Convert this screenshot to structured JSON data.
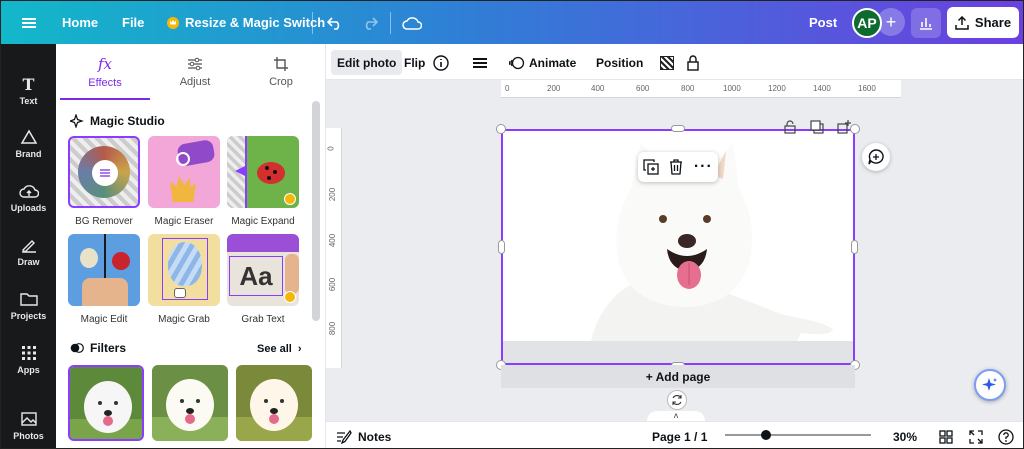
{
  "topbar": {
    "home": "Home",
    "file": "File",
    "resize": "Resize & Magic Switch",
    "post": "Post",
    "avatar": "AP",
    "share": "Share"
  },
  "rail": [
    {
      "label": "Text"
    },
    {
      "label": "Brand"
    },
    {
      "label": "Uploads"
    },
    {
      "label": "Draw"
    },
    {
      "label": "Projects"
    },
    {
      "label": "Apps"
    },
    {
      "label": "Photos"
    }
  ],
  "panel": {
    "tabs": [
      "Effects",
      "Adjust",
      "Crop"
    ],
    "tab_glyphs": [
      "fx"
    ],
    "magic_studio_title": "Magic Studio",
    "tools": [
      "BG Remover",
      "Magic Eraser",
      "Magic Expand",
      "Magic Edit",
      "Magic Grab",
      "Grab Text"
    ],
    "grab_text_tile": "Aa",
    "filters_title": "Filters",
    "see_all": "See all"
  },
  "context_toolbar": {
    "edit_photo": "Edit photo",
    "flip": "Flip",
    "animate": "Animate",
    "position": "Position"
  },
  "ruler": {
    "h_ticks": [
      "0",
      "200",
      "400",
      "600",
      "800",
      "1000",
      "1200",
      "1400",
      "1600"
    ],
    "v_ticks": [
      "0",
      "200",
      "400",
      "600",
      "800"
    ]
  },
  "canvas": {
    "add_page": "+ Add page"
  },
  "bottombar": {
    "notes": "Notes",
    "page": "Page 1 / 1",
    "zoom": "30%"
  },
  "colors": {
    "accent": "#8b3dff",
    "rail_bg": "#18191b",
    "avatar_bg": "#0e6b2f",
    "pro": "#f5b70a"
  }
}
